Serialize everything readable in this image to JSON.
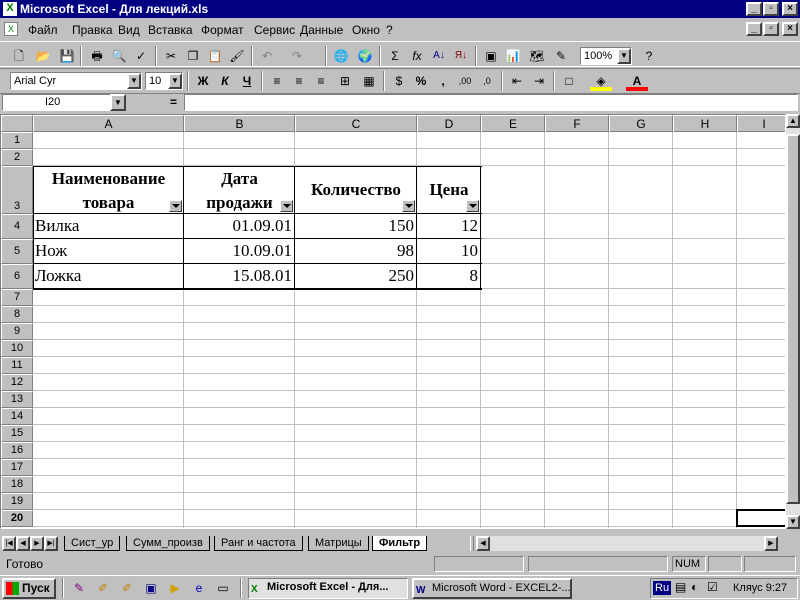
{
  "window": {
    "title": "Microsoft Excel - Для лекций.xls",
    "title_icon": "excel-icon"
  },
  "menu": [
    "Файл",
    "Правка",
    "Вид",
    "Вставка",
    "Формат",
    "Сервис",
    "Данные",
    "Окно",
    "?"
  ],
  "toolbar": {
    "zoom": "100%",
    "font_name": "Arial Cyr",
    "font_size": "10",
    "bold": "Ж",
    "italic": "К",
    "underline": "Ч",
    "percent": "%",
    "comma": ",",
    "sum": "Σ",
    "fx": "fx"
  },
  "formula_bar": {
    "name_box": "I20",
    "equals": "="
  },
  "columns": [
    "A",
    "B",
    "C",
    "D",
    "E",
    "F",
    "G",
    "H",
    "I"
  ],
  "rows": [
    "1",
    "2",
    "3",
    "4",
    "5",
    "6",
    "7",
    "8",
    "9",
    "10",
    "11",
    "12",
    "13",
    "14",
    "15",
    "16",
    "17",
    "18",
    "19",
    "20"
  ],
  "table": {
    "headers": [
      "Наименование товара",
      "Дата продажи",
      "Количество",
      "Цена"
    ],
    "header_lines": [
      [
        "Наименование",
        "товара"
      ],
      [
        "Дата",
        "продажи"
      ],
      [
        "Количество"
      ],
      [
        "Цена"
      ]
    ],
    "rows": [
      [
        "Вилка",
        "01.09.01",
        "150",
        "12"
      ],
      [
        "Нож",
        "10.09.01",
        "98",
        "10"
      ],
      [
        "Ложка",
        "15.08.01",
        "250",
        "8"
      ]
    ]
  },
  "sheet_tabs": [
    "Сист_ур",
    "Сумм_произв",
    "Ранг и частота",
    "Матрицы",
    "Фильтр"
  ],
  "active_sheet": "Фильтр",
  "status": {
    "text": "Готово",
    "num": "NUM"
  },
  "taskbar": {
    "start": "Пуск",
    "tasks": [
      "Microsoft Excel - Для...",
      "Microsoft Word - EXCEL2-..."
    ],
    "lang": "Ru",
    "clock": "Кляус 9:27"
  },
  "colors": {
    "title_bg": "#000080",
    "face": "#c0c0c0"
  }
}
